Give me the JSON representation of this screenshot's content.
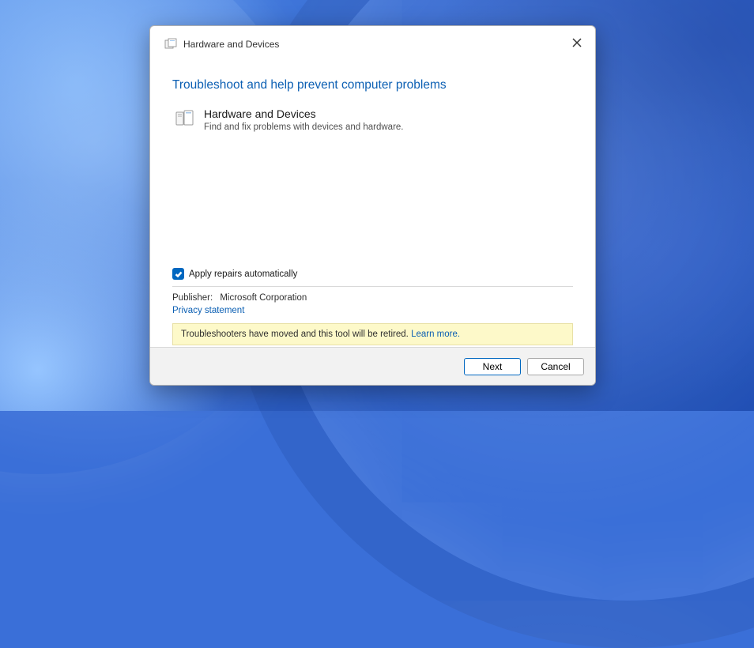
{
  "window": {
    "title": "Hardware and Devices"
  },
  "heading": "Troubleshoot and help prevent computer problems",
  "item": {
    "title": "Hardware and Devices",
    "description": "Find and fix problems with devices and hardware."
  },
  "checkbox": {
    "label": "Apply repairs automatically",
    "checked": true
  },
  "publisher": {
    "label": "Publisher:",
    "value": "Microsoft Corporation"
  },
  "privacy_link": "Privacy statement",
  "notice": {
    "text": "Troubleshooters have moved and this tool will be retired. ",
    "link": "Learn more."
  },
  "buttons": {
    "next": "Next",
    "cancel": "Cancel"
  }
}
